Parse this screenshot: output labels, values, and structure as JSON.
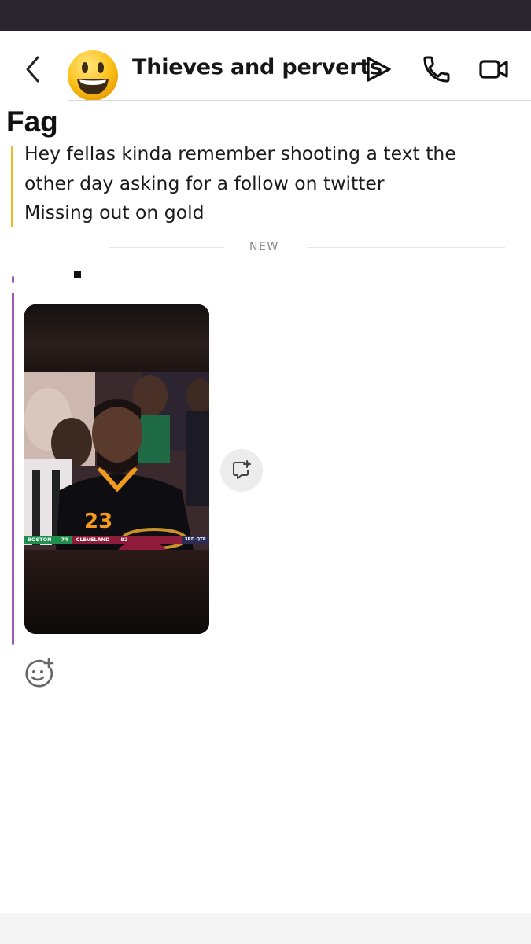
{
  "header": {
    "title": "Thieves and perverts",
    "avatar_emoji": "😃",
    "icons": {
      "back": "chevron-left-icon",
      "story": "play-icon",
      "call": "phone-icon",
      "video": "video-camera-icon"
    }
  },
  "messages": [
    {
      "sender": "Fag",
      "accent_color": "#f2b722",
      "lines": [
        "Hey fellas kinda remember shooting a text the",
        "other day asking for a follow on twitter",
        "Missing out on gold"
      ]
    }
  ],
  "separator": {
    "label": "NEW"
  },
  "media_message": {
    "accent_color": "#9b59b6",
    "scoreboard": {
      "team1": "BOSTON",
      "score1": "74",
      "team2": "CLEVELAND",
      "score2": "92",
      "period": "3RD QTR"
    },
    "jersey_number": "23",
    "save_icon": "save-to-chat-icon"
  },
  "reaction": {
    "icon": "add-reaction-icon"
  }
}
